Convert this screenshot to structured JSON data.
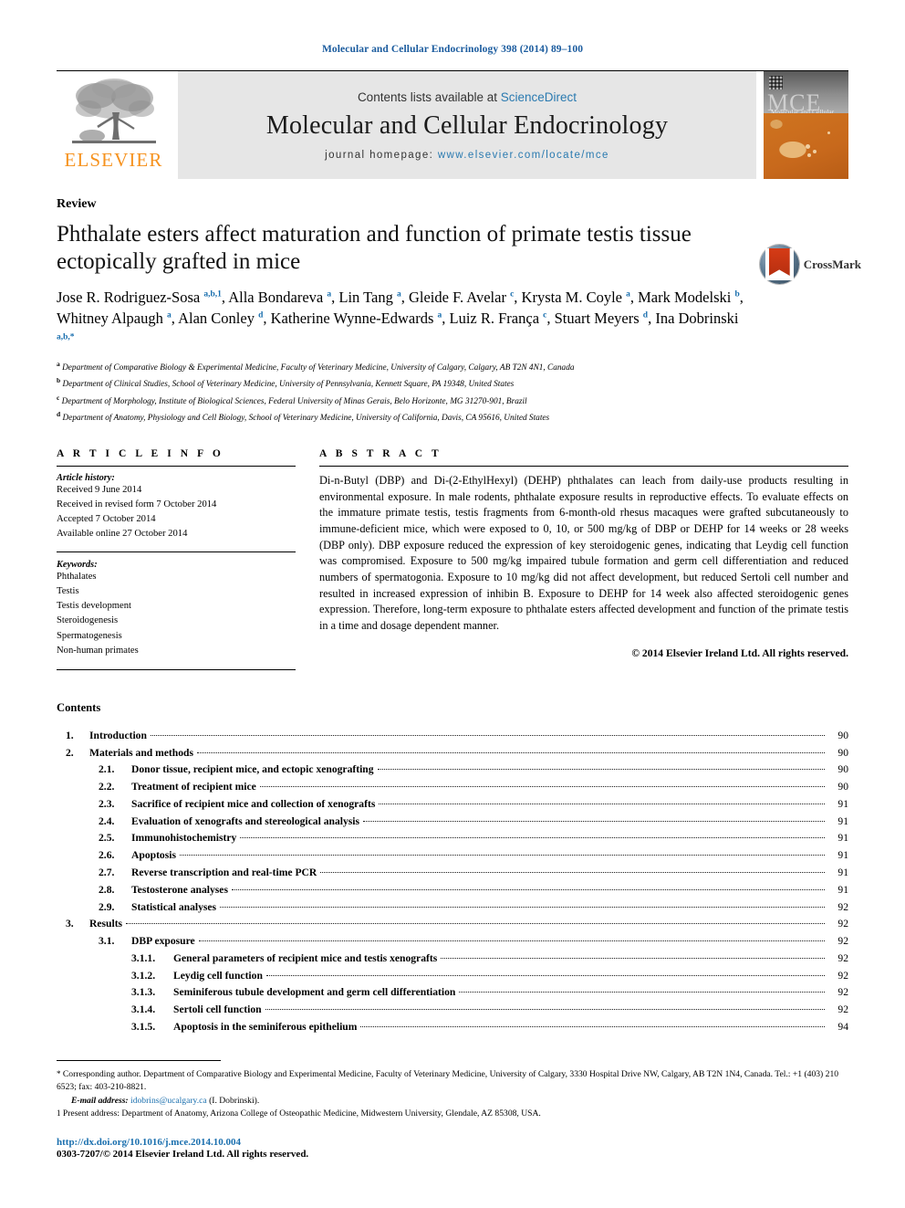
{
  "running_head": "Molecular and Cellular Endocrinology 398 (2014) 89–100",
  "masthead": {
    "contents_prefix": "Contents lists available at ",
    "sciencedirect": "ScienceDirect",
    "journal_title": "Molecular and Cellular Endocrinology",
    "homepage_prefix": "journal homepage: ",
    "homepage_url": "www.elsevier.com/locate/mce",
    "publisher": "ELSEVIER",
    "cover_abbrev": "MCE",
    "cover_subtitle": "Molecular and Cellular Endocrinology",
    "accent_orange": "#f6921e",
    "link_blue": "#2a7ab0"
  },
  "article": {
    "type": "Review",
    "title": "Phthalate esters affect maturation and function of primate testis tissue ectopically grafted in mice",
    "authors": [
      {
        "name": "Jose R. Rodriguez-Sosa",
        "sup": "a,b,1",
        "sep": ", "
      },
      {
        "name": "Alla Bondareva",
        "sup": "a",
        "sep": ", "
      },
      {
        "name": "Lin Tang",
        "sup": "a",
        "sep": ", "
      },
      {
        "name": "Gleide F. Avelar",
        "sup": "c",
        "sep": ", "
      },
      {
        "name": "Krysta M. Coyle",
        "sup": "a",
        "sep": ", "
      },
      {
        "name": "Mark Modelski",
        "sup": "b",
        "sep": ", "
      },
      {
        "name": "Whitney Alpaugh",
        "sup": "a",
        "sep": ", "
      },
      {
        "name": "Alan Conley",
        "sup": "d",
        "sep": ", "
      },
      {
        "name": "Katherine Wynne-Edwards",
        "sup": "a",
        "sep": ", "
      },
      {
        "name": "Luiz R. França",
        "sup": "c",
        "sep": ", "
      },
      {
        "name": "Stuart Meyers",
        "sup": "d",
        "sep": ", "
      },
      {
        "name": "Ina Dobrinski",
        "sup": "a,b,*",
        "sep": ""
      }
    ],
    "affiliations": [
      {
        "mark": "a",
        "text": "Department of Comparative Biology & Experimental Medicine, Faculty of Veterinary Medicine, University of Calgary, Calgary, AB T2N 4N1, Canada"
      },
      {
        "mark": "b",
        "text": "Department of Clinical Studies, School of Veterinary Medicine, University of Pennsylvania, Kennett Square, PA 19348, United States"
      },
      {
        "mark": "c",
        "text": "Department of Morphology, Institute of Biological Sciences, Federal University of Minas Gerais, Belo Horizonte, MG 31270-901, Brazil"
      },
      {
        "mark": "d",
        "text": "Department of Anatomy, Physiology and Cell Biology, School of Veterinary Medicine, University of California, Davis, CA 95616, United States"
      }
    ],
    "crossmark_label": "CrossMark"
  },
  "article_info": {
    "heading": "A R T I C L E   I N F O",
    "history_label": "Article history:",
    "history": [
      "Received 9 June 2014",
      "Received in revised form 7 October 2014",
      "Accepted 7 October 2014",
      "Available online 27 October 2014"
    ],
    "keywords_label": "Keywords:",
    "keywords": [
      "Phthalates",
      "Testis",
      "Testis development",
      "Steroidogenesis",
      "Spermatogenesis",
      "Non-human primates"
    ]
  },
  "abstract": {
    "heading": "A B S T R A C T",
    "body": "Di-n-Butyl (DBP) and Di-(2-EthylHexyl) (DEHP) phthalates can leach from daily-use products resulting in environmental exposure. In male rodents, phthalate exposure results in reproductive effects. To evaluate effects on the immature primate testis, testis fragments from 6-month-old rhesus macaques were grafted subcutaneously to immune-deficient mice, which were exposed to 0, 10, or 500 mg/kg of DBP or DEHP for 14 weeks or 28 weeks (DBP only). DBP exposure reduced the expression of key steroidogenic genes, indicating that Leydig cell function was compromised. Exposure to 500 mg/kg impaired tubule formation and germ cell differentiation and reduced numbers of spermatogonia. Exposure to 10 mg/kg did not affect development, but reduced Sertoli cell number and resulted in increased expression of inhibin B. Exposure to DEHP for 14 week also affected steroidogenic genes expression. Therefore, long-term exposure to phthalate esters affected development and function of the primate testis in a time and dosage dependent manner.",
    "copyright": "© 2014 Elsevier Ireland Ltd. All rights reserved."
  },
  "contents": {
    "heading": "Contents",
    "entries": [
      {
        "level": 1,
        "num": "1.",
        "label": "Introduction",
        "page": "90"
      },
      {
        "level": 1,
        "num": "2.",
        "label": "Materials and methods",
        "page": "90"
      },
      {
        "level": 2,
        "num": "2.1.",
        "label": "Donor tissue, recipient mice, and ectopic xenografting",
        "page": "90"
      },
      {
        "level": 2,
        "num": "2.2.",
        "label": "Treatment of recipient mice",
        "page": "90"
      },
      {
        "level": 2,
        "num": "2.3.",
        "label": "Sacrifice of recipient mice and collection of xenografts",
        "page": "91"
      },
      {
        "level": 2,
        "num": "2.4.",
        "label": "Evaluation of xenografts and stereological analysis",
        "page": "91"
      },
      {
        "level": 2,
        "num": "2.5.",
        "label": "Immunohistochemistry",
        "page": "91"
      },
      {
        "level": 2,
        "num": "2.6.",
        "label": "Apoptosis",
        "page": "91"
      },
      {
        "level": 2,
        "num": "2.7.",
        "label": "Reverse transcription and real-time PCR",
        "page": "91"
      },
      {
        "level": 2,
        "num": "2.8.",
        "label": "Testosterone analyses",
        "page": "91"
      },
      {
        "level": 2,
        "num": "2.9.",
        "label": "Statistical analyses",
        "page": "92"
      },
      {
        "level": 1,
        "num": "3.",
        "label": "Results",
        "page": "92"
      },
      {
        "level": 2,
        "num": "3.1.",
        "label": "DBP exposure",
        "page": "92"
      },
      {
        "level": 3,
        "num": "3.1.1.",
        "label": "General parameters of recipient mice and testis xenografts",
        "page": "92"
      },
      {
        "level": 3,
        "num": "3.1.2.",
        "label": "Leydig cell function",
        "page": "92"
      },
      {
        "level": 3,
        "num": "3.1.3.",
        "label": "Seminiferous tubule development and germ cell differentiation",
        "page": "92"
      },
      {
        "level": 3,
        "num": "3.1.4.",
        "label": "Sertoli cell function",
        "page": "92"
      },
      {
        "level": 3,
        "num": "3.1.5.",
        "label": "Apoptosis in the seminiferous epithelium",
        "page": "94"
      }
    ]
  },
  "footnotes": {
    "corresponding_mark": "*",
    "corresponding": "Corresponding author. Department of Comparative Biology and Experimental Medicine, Faculty of Veterinary Medicine, University of Calgary, 3330 Hospital Drive NW, Calgary, AB T2N 1N4, Canada. Tel.: +1 (403) 210 6523; fax: 403-210-8821.",
    "email_label": "E-mail address:",
    "email": "idobrins@ucalgary.ca",
    "email_suffix": "(I. Dobrinski).",
    "present_mark": "1",
    "present_address": "Present address: Department of Anatomy, Arizona College of Osteopathic Medicine, Midwestern University, Glendale, AZ 85308, USA.",
    "doi": "http://dx.doi.org/10.1016/j.mce.2014.10.004",
    "issn": "0303-7207/© 2014 Elsevier Ireland Ltd. All rights reserved."
  }
}
